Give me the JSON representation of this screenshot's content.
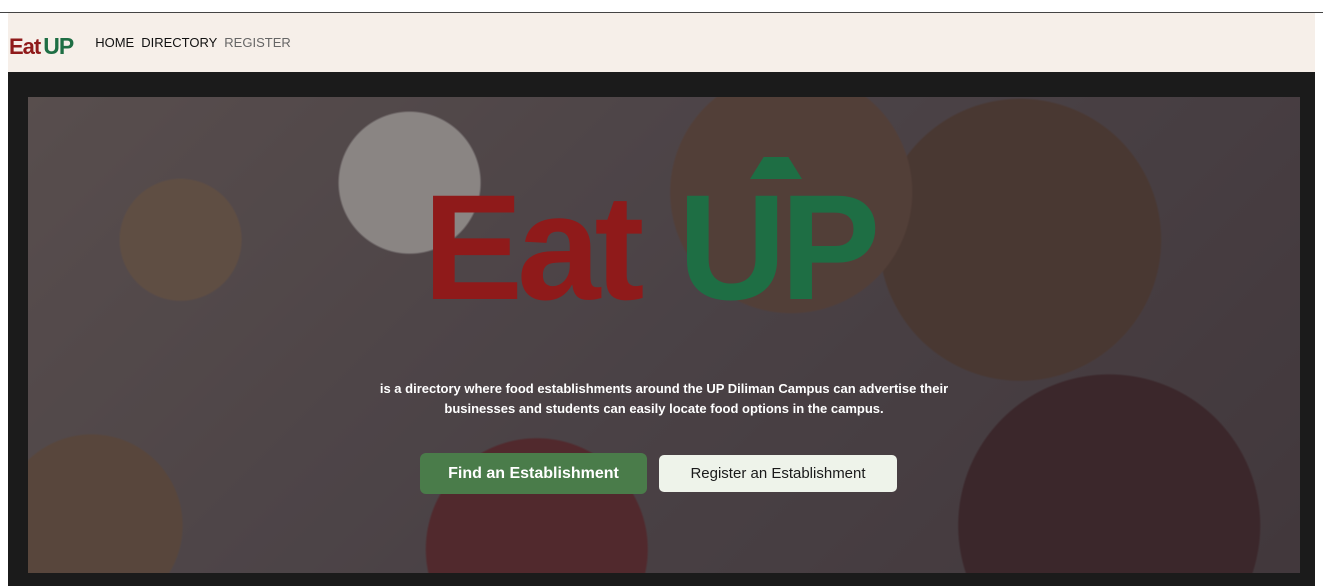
{
  "colors": {
    "brand_red": "#8f1a1a",
    "brand_green": "#1e6e44",
    "nav_bg": "#f6efe9",
    "nav_active": "#111111",
    "nav_inactive": "#666666",
    "find_button_bg": "#4a7c4a",
    "register_button_bg": "#eef3ea"
  },
  "navbar": {
    "brand_eat": "Eat",
    "brand_up": "UP",
    "links": [
      {
        "label": "HOME",
        "active": true
      },
      {
        "label": "DIRECTORY",
        "active": true
      },
      {
        "label": "REGISTER",
        "active": false
      }
    ]
  },
  "hero": {
    "logo_eat": "Eat",
    "logo_up": "UP",
    "tagline_line1": "is a directory where food establishments around the UP Diliman Campus can advertise their",
    "tagline_line2": "businesses and students can easily locate food options in the campus.",
    "find_button": "Find an Establishment",
    "register_button": "Register an Establishment"
  }
}
